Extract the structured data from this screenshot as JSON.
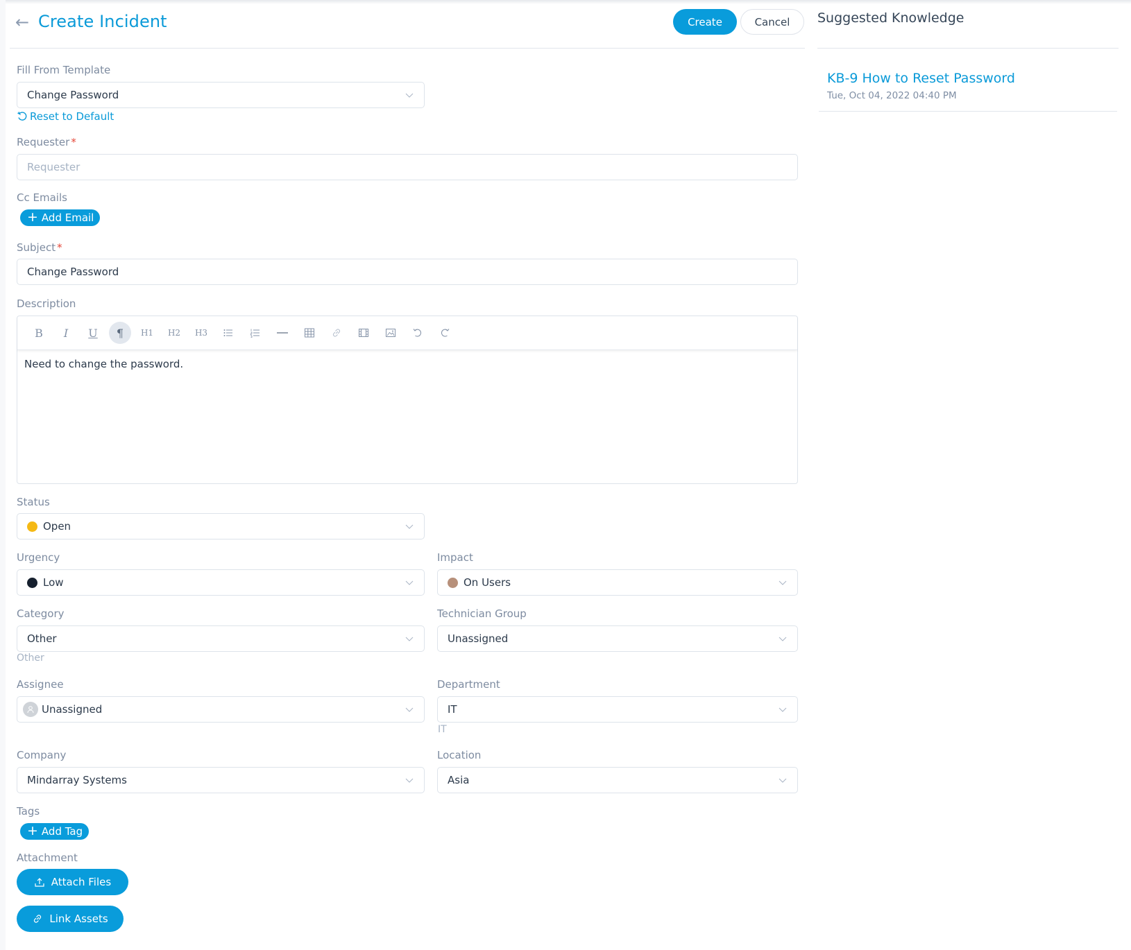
{
  "header": {
    "back_label": "←",
    "title": "Create Incident",
    "create_label": "Create",
    "cancel_label": "Cancel"
  },
  "knowledge": {
    "title": "Suggested Knowledge",
    "items": [
      {
        "title": "KB-9 How to Reset Password",
        "date": "Tue, Oct 04, 2022 04:40 PM"
      }
    ]
  },
  "form": {
    "template": {
      "label": "Fill From Template",
      "value": "Change Password",
      "reset_label": "Reset to Default"
    },
    "requester": {
      "label": "Requester",
      "required": "*",
      "placeholder": "Requester",
      "value": ""
    },
    "cc_emails": {
      "label": "Cc Emails",
      "add_label": "Add Email"
    },
    "subject": {
      "label": "Subject",
      "required": "*",
      "value": "Change Password"
    },
    "description": {
      "label": "Description",
      "toolbar": [
        "bold",
        "italic",
        "underline",
        "paragraph",
        "H1",
        "H2",
        "H3",
        "bullet-list",
        "ordered-list",
        "horizontal-rule",
        "table",
        "link",
        "video",
        "image",
        "undo",
        "redo"
      ],
      "toolbar_text": {
        "bold": "B",
        "italic": "I",
        "underline": "U",
        "paragraph": "¶",
        "h1": "H1",
        "h2": "H2",
        "h3": "H3"
      },
      "value": "Need to change the password."
    },
    "status": {
      "label": "Status",
      "value": "Open",
      "color": "#f5b914"
    },
    "urgency": {
      "label": "Urgency",
      "value": "Low",
      "color": "#16202e"
    },
    "impact": {
      "label": "Impact",
      "value": "On Users",
      "color": "#b7907a"
    },
    "category": {
      "label": "Category",
      "value": "Other",
      "hint": "Other"
    },
    "technician_group": {
      "label": "Technician Group",
      "value": "Unassigned"
    },
    "assignee": {
      "label": "Assignee",
      "value": "Unassigned"
    },
    "department": {
      "label": "Department",
      "value": "IT",
      "hint": "IT"
    },
    "company": {
      "label": "Company",
      "value": "Mindarray Systems"
    },
    "location": {
      "label": "Location",
      "value": "Asia"
    },
    "tags": {
      "label": "Tags",
      "add_label": "Add Tag"
    },
    "attachment": {
      "label": "Attachment",
      "attach_label": "Attach Files",
      "link_label": "Link Assets"
    }
  },
  "colors": {
    "accent": "#099cdb",
    "required": "#e5493a"
  }
}
